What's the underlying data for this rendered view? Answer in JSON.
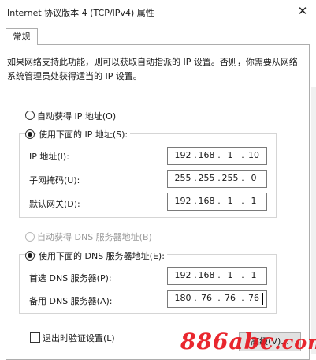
{
  "window": {
    "title": "Internet 协议版本 4 (TCP/IPv4) 属性",
    "close_glyph": "✕"
  },
  "tab": {
    "label": "常规"
  },
  "description": "如果网络支持此功能，则可以获取自动指派的 IP 设置。否则，你需要从网络系统管理员处获得适当的 IP 设置。",
  "ip_section": {
    "auto_label": "自动获得 IP 地址(O)",
    "manual_label": "使用下面的 IP 地址(S):",
    "manual_selected": true,
    "fields": [
      {
        "label": "IP 地址(I):",
        "octets": [
          "192",
          "168",
          "1",
          "10"
        ]
      },
      {
        "label": "子网掩码(U):",
        "octets": [
          "255",
          "255",
          "255",
          "0"
        ]
      },
      {
        "label": "默认网关(D):",
        "octets": [
          "192",
          "168",
          "1",
          "1"
        ]
      }
    ]
  },
  "dns_section": {
    "auto_label": "自动获得 DNS 服务器地址(B)",
    "auto_disabled": true,
    "manual_label": "使用下面的 DNS 服务器地址(E):",
    "manual_selected": true,
    "fields": [
      {
        "label": "首选 DNS 服务器(P):",
        "octets": [
          "192",
          "168",
          "1",
          "1"
        ]
      },
      {
        "label": "备用 DNS 服务器(A):",
        "octets": [
          "180",
          "76",
          "76",
          "76"
        ]
      }
    ]
  },
  "validate_checkbox": {
    "label": "退出时验证设置(L)",
    "checked": false
  },
  "advanced_button": {
    "label": "高级(V)..."
  },
  "watermark": {
    "main": "886abc",
    "suffix": ".com"
  }
}
